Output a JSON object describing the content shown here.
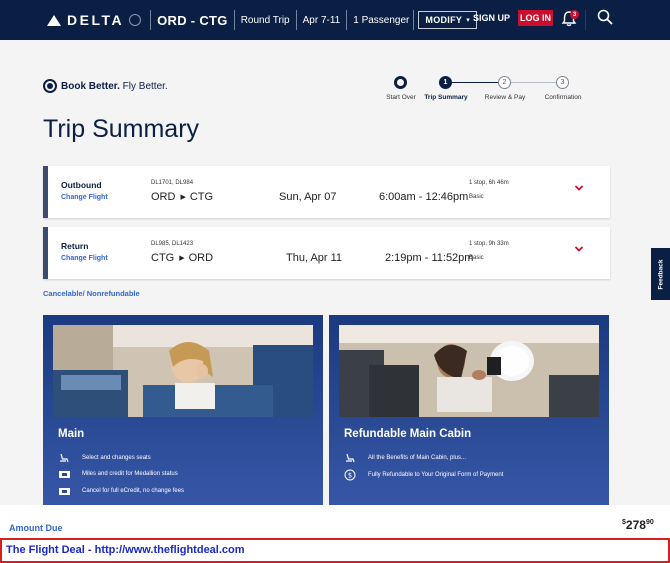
{
  "header": {
    "logo_text": "DELTA",
    "route": "ORD - CTG",
    "trip_type": "Round Trip",
    "dates": "Apr 7-11",
    "passengers": "1 Passenger",
    "modify_label": "MODIFY",
    "signup_label": "SIGN UP",
    "login_label": "LOG IN",
    "notification_count": "3"
  },
  "brand": {
    "bold": "Book Better.",
    "rest": " Fly Better."
  },
  "steps": [
    {
      "label": "Start Over",
      "num": "",
      "state": "done"
    },
    {
      "label": "Trip Summary",
      "num": "1",
      "state": "current"
    },
    {
      "label": "Review & Pay",
      "num": "2",
      "state": "todo"
    },
    {
      "label": "Confirmation",
      "num": "3",
      "state": "todo"
    }
  ],
  "page_title": "Trip Summary",
  "flights": [
    {
      "type": "Outbound",
      "change_label": "Change Flight",
      "flight_numbers": "DL1701, DL984",
      "from": "ORD",
      "to": "CTG",
      "date": "Sun, Apr 07",
      "times": "6:00am - 12:46pm",
      "stops": "1 stop, 6h 46m",
      "class": "Basic"
    },
    {
      "type": "Return",
      "change_label": "Change Flight",
      "flight_numbers": "DL985, DL1423",
      "from": "CTG",
      "to": "ORD",
      "date": "Thu, Apr 11",
      "times": "2:19pm - 11:52pm",
      "stops": "1 stop, 9h 33m",
      "class": "Basic"
    }
  ],
  "cancel_policy": "Cancelable/ Nonrefundable",
  "fares": [
    {
      "name": "Main",
      "features": [
        {
          "icon": "seat-icon",
          "text": "Select and changes seats"
        },
        {
          "icon": "ticket-icon",
          "text": "Miles and credit for Medallion status"
        },
        {
          "icon": "ticket-icon",
          "text": "Cancel for full eCredit, no change fees"
        }
      ]
    },
    {
      "name": "Refundable Main Cabin",
      "features": [
        {
          "icon": "seat-icon",
          "text": "All the Benefits of Main Cabin, plus..."
        },
        {
          "icon": "dollar-icon",
          "text": "Fully Refundable to Your Original Form of Payment"
        }
      ]
    }
  ],
  "feedback_label": "Feedback",
  "amount": {
    "label": "Amount Due",
    "currency": "$",
    "dollars": "278",
    "cents": "90"
  },
  "watermark": "The Flight Deal - http://www.theflightdeal.com",
  "colors": {
    "navy": "#0b1f44",
    "red": "#c8102e",
    "link": "#3366cc",
    "card_blue": "#2a4a95"
  }
}
